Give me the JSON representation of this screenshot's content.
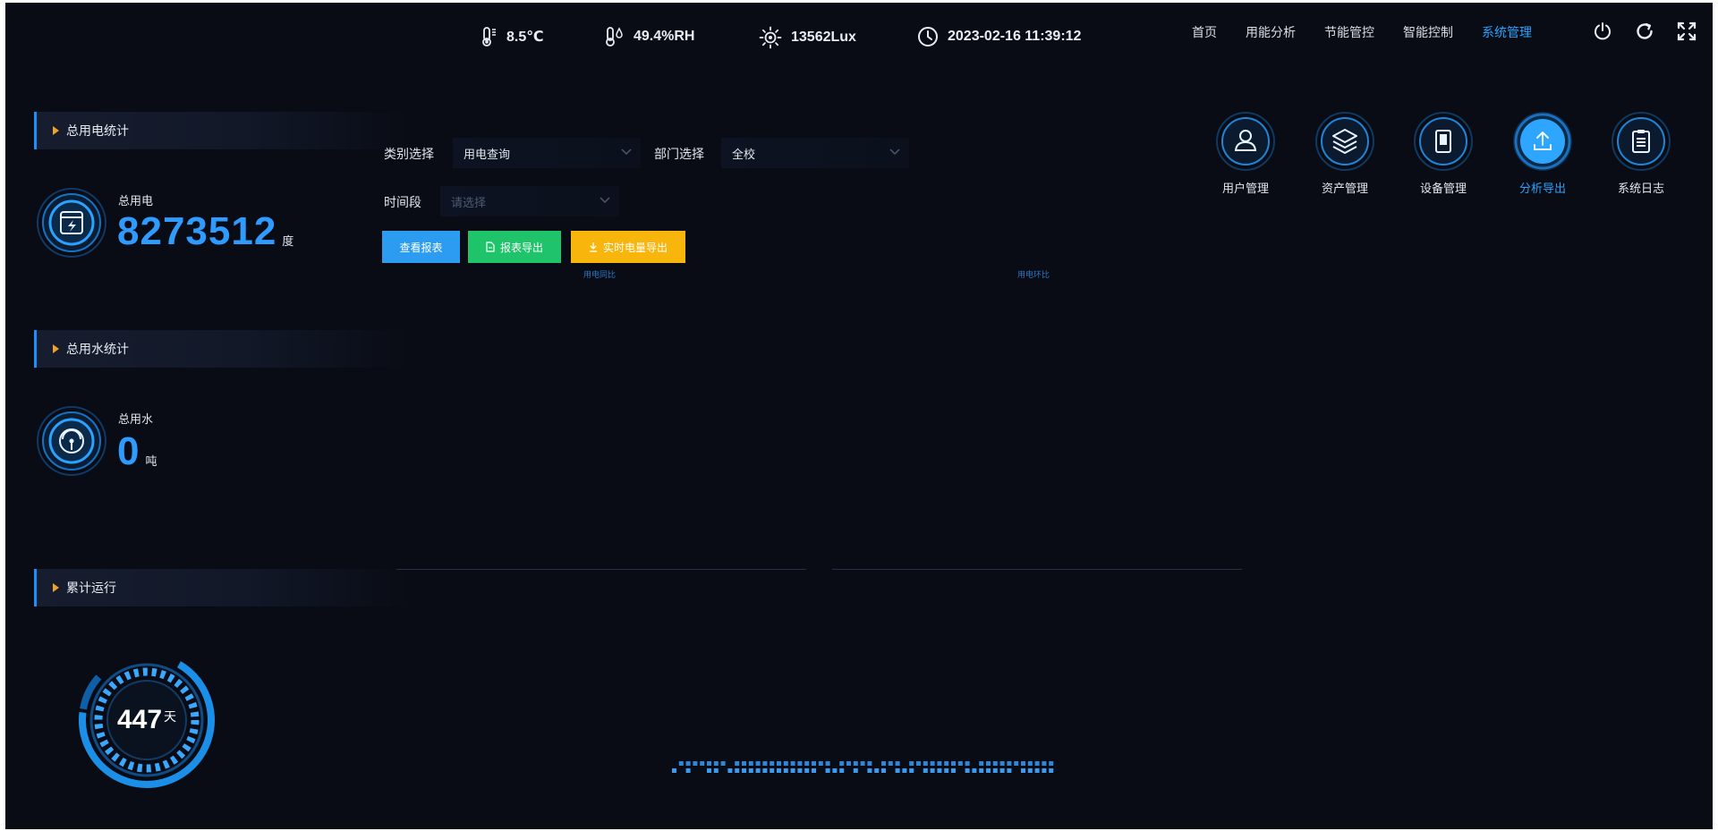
{
  "topbar": {
    "temperature": "8.5℃",
    "humidity": "49.4%RH",
    "illuminance": "13562Lux",
    "datetime": "2023-02-16 11:39:12"
  },
  "nav": {
    "items": [
      "首页",
      "用能分析",
      "节能管控",
      "智能控制",
      "系统管理"
    ],
    "active_index": 4
  },
  "left": {
    "power_section_title": "总用电统计",
    "power_label": "总用电",
    "power_value": "8273512",
    "power_unit": "度",
    "water_section_title": "总用水统计",
    "water_label": "总用水",
    "water_value": "0",
    "water_unit": "吨",
    "run_section_title": "累计运行",
    "run_days": "447",
    "run_unit": "天"
  },
  "filters": {
    "category_label": "类别选择",
    "category_value": "用电查询",
    "dept_label": "部门选择",
    "dept_value": "全校",
    "time_label": "时间段",
    "time_placeholder": "请选择"
  },
  "buttons": {
    "view_report": "查看报表",
    "export_report": "报表导出",
    "realtime_export": "实时电量导出"
  },
  "charts": {
    "caption_1": "用电同比",
    "caption_2": "用电环比"
  },
  "functions": {
    "items": [
      "用户管理",
      "资产管理",
      "设备管理",
      "分析导出",
      "系统日志"
    ],
    "active_index": 3
  },
  "colors": {
    "background": "#090c15",
    "accent": "#2aa2ff",
    "number_blue": "#2f9bff",
    "marker_orange": "#f0a321",
    "btn_blue": "#2b9cf0",
    "btn_green": "#1ec36a",
    "btn_yellow": "#f8b60c"
  }
}
